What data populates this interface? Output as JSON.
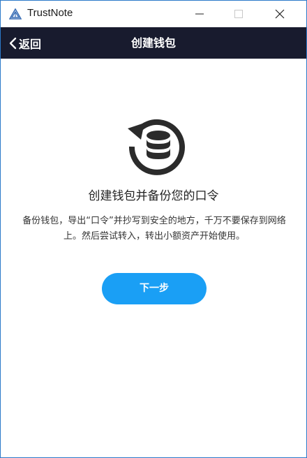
{
  "window": {
    "title": "TrustNote",
    "icons": {
      "logo": "trustnote-logo-icon",
      "minimize": "minimize-icon",
      "maximize": "maximize-icon",
      "close": "close-icon"
    }
  },
  "navbar": {
    "back_label": "返回",
    "back_icon": "chevron-left-icon",
    "title": "创建钱包",
    "background": "#181b2e"
  },
  "main": {
    "icon": "database-refresh-icon",
    "heading": "创建钱包并备份您的口令",
    "description": "备份钱包，导出“口令”并抄写到安全的地方，千万不要保存到网络上。然后尝试转入，转出小额资产开始使用。",
    "next_button": "下一步",
    "accent_color": "#1a9ff5"
  }
}
